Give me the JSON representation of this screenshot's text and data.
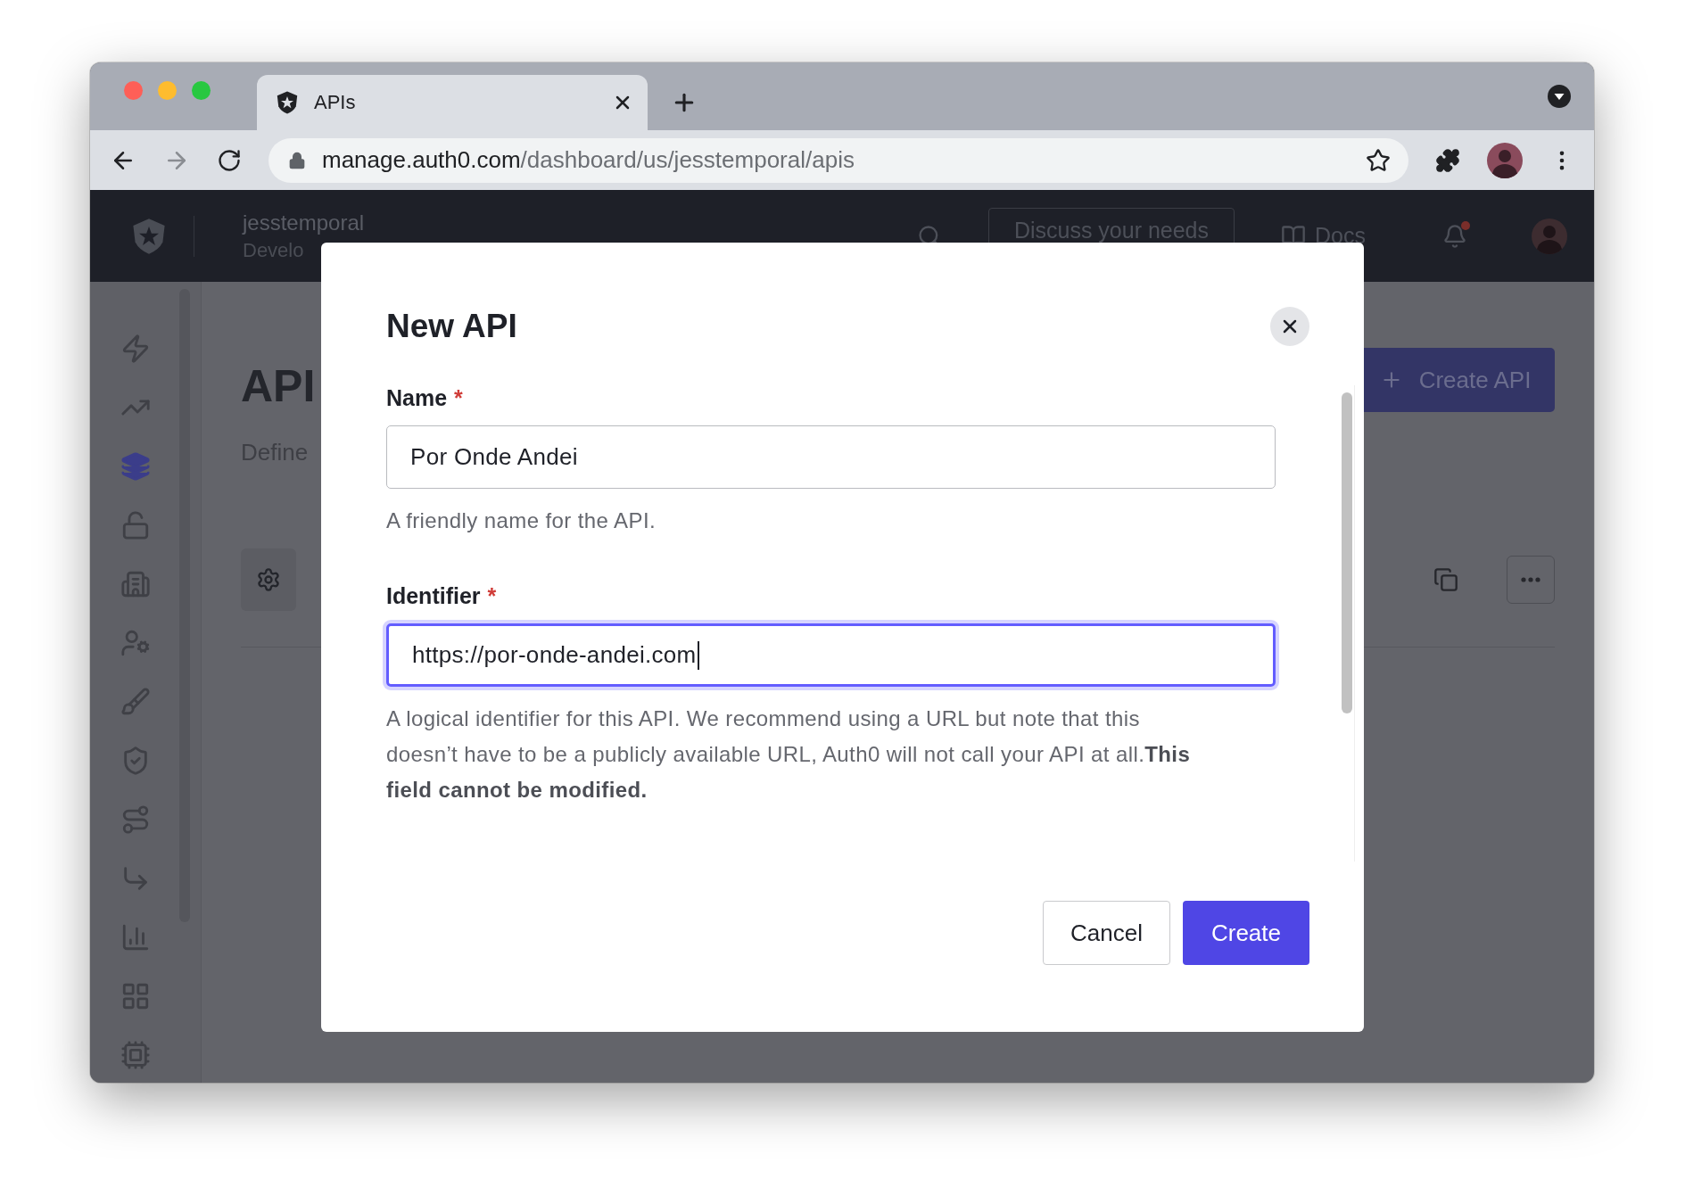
{
  "browser": {
    "tab": {
      "title": "APIs"
    },
    "url": {
      "host": "manage.auth0.com",
      "path": "/dashboard/us/jesstemporal/apis"
    }
  },
  "header": {
    "tenant": "jesstemporal",
    "environment": "Develo",
    "discuss_button": "Discuss your needs",
    "docs_link": "Docs",
    "unread_notifications": true
  },
  "sidebar": {
    "items": [
      {
        "selected": false
      },
      {
        "selected": false
      },
      {
        "selected": true
      },
      {
        "selected": false
      },
      {
        "selected": false
      },
      {
        "selected": false
      },
      {
        "selected": false
      },
      {
        "selected": false
      },
      {
        "selected": false
      },
      {
        "selected": false
      },
      {
        "selected": false
      },
      {
        "selected": false
      },
      {
        "selected": false
      }
    ]
  },
  "page": {
    "title": "API",
    "description": "Define",
    "create_button": "Create API"
  },
  "modal": {
    "title": "New API",
    "fields": [
      {
        "label": "Name",
        "required_mark": "*",
        "value": "Por Onde Andei",
        "focused": false,
        "help": "A friendly name for the API."
      },
      {
        "label": "Identifier",
        "required_mark": "*",
        "value": "https://por-onde-andei.com",
        "focused": true,
        "help": "A logical identifier for this API. We recommend using a URL but note that this doesn’t have to be a publicly available URL, Auth0 will not call your API at all.**This field cannot be modified.**"
      }
    ],
    "buttons": [
      {
        "label": "Cancel",
        "kind": "secondary"
      },
      {
        "label": "Create",
        "kind": "primary"
      }
    ]
  }
}
